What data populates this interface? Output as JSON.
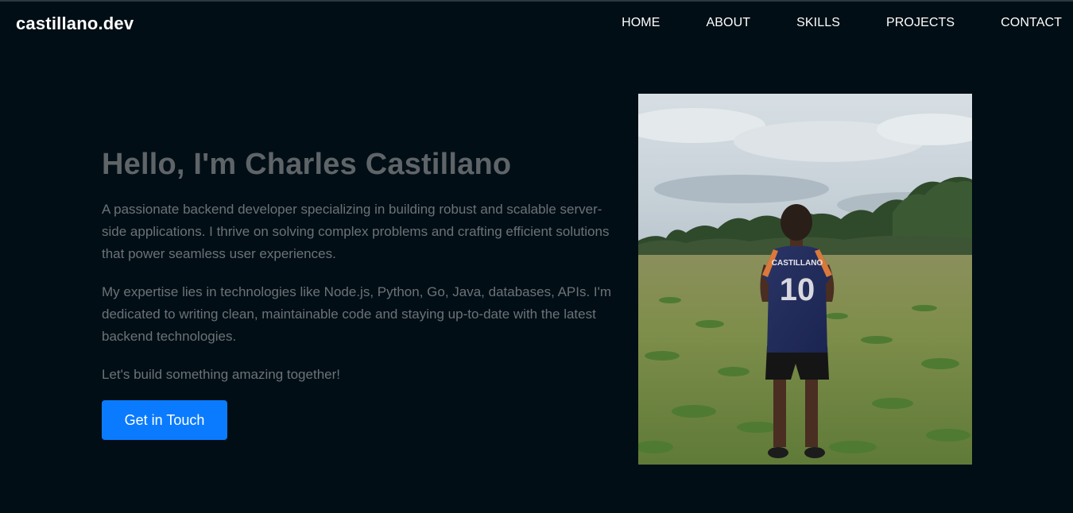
{
  "brand": {
    "logo_text": "castillano.dev"
  },
  "nav": {
    "items": [
      "HOME",
      "ABOUT",
      "SKILLS",
      "PROJECTS",
      "CONTACT"
    ]
  },
  "hero": {
    "title": "Hello, I'm Charles Castillano",
    "paragraphs": [
      "A passionate backend developer specializing in building robust and scalable server-side applications. I thrive on solving complex problems and crafting efficient solutions that power seamless user experiences.",
      "My expertise lies in technologies like Node.js, Python, Go, Java, databases, APIs. I'm dedicated to writing clean, maintainable code and staying up-to-date with the latest backend technologies.",
      "Let's build something amazing together!"
    ],
    "cta_label": "Get in Touch"
  },
  "photo": {
    "jersey_name": "CASTILLANO",
    "jersey_number": "10"
  },
  "colors": {
    "background": "#010e15",
    "accent": "#0a7bff",
    "nav_text": "#ffffff",
    "heading": "#5f6468",
    "body_text": "#6c7277"
  }
}
